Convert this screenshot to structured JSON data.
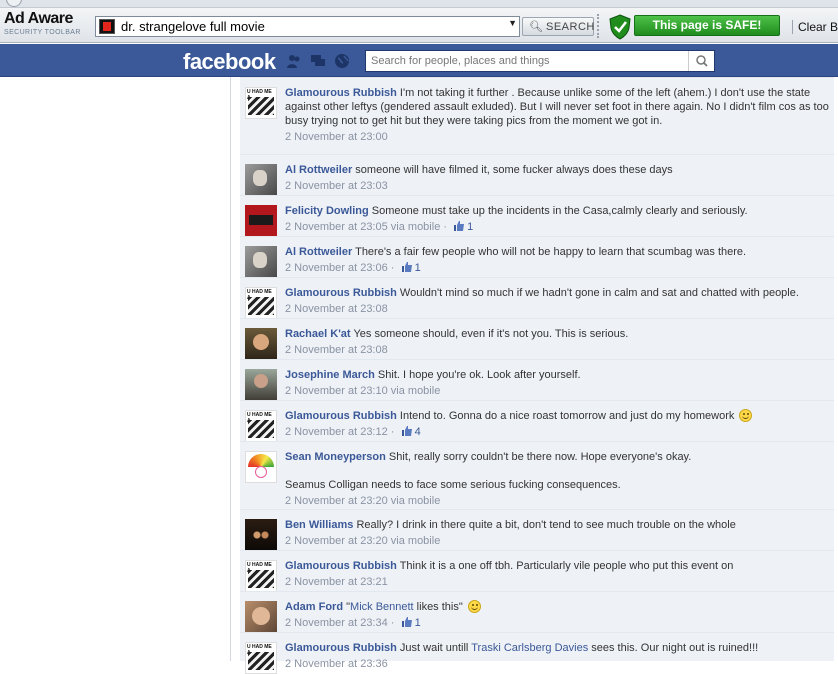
{
  "adaware": {
    "logo_line1": "Ad Aware",
    "logo_line2": "SECURITY TOOLBAR",
    "address_value": "dr. strangelove full movie",
    "search_label": "SEARCH",
    "safe_label": "This page is SAFE!",
    "clear_label": "Clear Br"
  },
  "facebook": {
    "logo": "facebook",
    "search_placeholder": "Search for people, places and things"
  },
  "colors": {
    "fb_blue": "#3b5998",
    "comment_bg": "#eef1f6",
    "safe_green": "#2ea12b"
  },
  "comments": [
    {
      "author": "Glamourous Rubbish",
      "text": "I'm not taking it further . Because unlike some of the left (ahem.) I don't use the state against other leftys (gendered assault exluded). But I will never set foot in there again. No I didn't film cos as too busy trying not to get hit but they were taking pics from the moment we got in.",
      "time": "2 November at 23:00"
    },
    {
      "author": "Al Rottweiler",
      "text": "someone will have filmed it, some fucker always does these days",
      "time": "2 November at 23:03"
    },
    {
      "author": "Felicity Dowling",
      "text": "Someone must take up the incidents in the Casa,calmly clearly and seriously.",
      "time": "2 November at 23:05 via mobile · ",
      "likes": "1"
    },
    {
      "author": "Al Rottweiler",
      "text": "There's a fair few people who will not be happy to learn that scumbag was there.",
      "time": "2 November at 23:06 · ",
      "likes": "1"
    },
    {
      "author": "Glamourous Rubbish",
      "text": "Wouldn't mind so much if we hadn't gone in calm and sat and chatted with people.",
      "time": "2 November at 23:08"
    },
    {
      "author": "Rachael K'at",
      "text": "Yes someone should, even if it's not you. This is serious.",
      "time": "2 November at 23:08"
    },
    {
      "author": "Josephine March",
      "text": "Shit. I hope you're ok. Look after yourself.",
      "time": "2 November at 23:10 via mobile"
    },
    {
      "author": "Glamourous Rubbish",
      "text": "Intend to. Gonna do a nice roast tomorrow and just do my homework",
      "time": "2 November at 23:12 · ",
      "likes": "4"
    },
    {
      "author": "Sean Moneyperson",
      "text": "Shit, really sorry couldn't be there now. Hope everyone's okay.",
      "text2": "Seamus Colligan needs to face some serious fucking consequences.",
      "time": "2 November at 23:20 via mobile"
    },
    {
      "author": "Ben Williams",
      "text": "Really? I drink in there quite a bit, don't tend to see much trouble on the whole",
      "time": "2 November at 23:20 via mobile"
    },
    {
      "author": "Glamourous Rubbish",
      "text": "Think it is a one off tbh. Particularly vile people who put this event on",
      "time": "2 November at 23:21"
    },
    {
      "author": "Adam Ford",
      "text_pre": "\"",
      "text_link": "Mick Bennett",
      "text_post": " likes this\"",
      "time": "2 November at 23:34 · ",
      "likes": "1"
    },
    {
      "author": "Glamourous Rubbish",
      "text_pre": "Just wait untill ",
      "text_link": "Traski Carlsberg Davies",
      "text_post": " sees this. Our night out is ruined!!!",
      "time": "2 November at 23:36"
    }
  ]
}
